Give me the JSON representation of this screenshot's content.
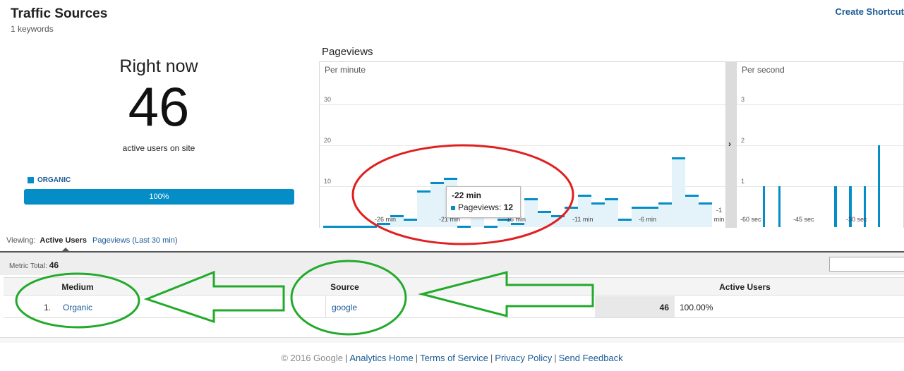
{
  "header": {
    "title": "Traffic Sources",
    "subtitle": "1 keywords",
    "create_shortcut": "Create Shortcut"
  },
  "right_now": {
    "heading": "Right now",
    "count": "46",
    "caption": "active users on site",
    "legend_label": "ORGANIC",
    "share_percent": "100%",
    "share_fraction": 1.0
  },
  "pageviews": {
    "title": "Pageviews",
    "per_minute_label": "Per minute",
    "per_second_label": "Per second",
    "divider_icon": "chevron-right-icon"
  },
  "chart_data": [
    {
      "type": "bar",
      "title": "Per minute",
      "y_ticks": [
        "10",
        "20",
        "30"
      ],
      "ylim": [
        0,
        30
      ],
      "x_ticks": [
        "-26 min",
        "-21 min",
        "-16 min",
        "-11 min",
        "-6 min",
        "-1 min"
      ],
      "values": [
        0,
        0,
        0,
        0,
        1,
        3,
        2,
        9,
        11,
        12,
        0,
        3,
        0,
        2,
        1,
        7,
        4,
        3,
        5,
        8,
        6,
        7,
        2,
        5,
        5,
        6,
        17,
        8,
        6
      ],
      "color": "#058dc7",
      "tooltip": {
        "label": "-22 min",
        "series": "Pageviews:",
        "value": "12"
      }
    },
    {
      "type": "bar",
      "title": "Per second",
      "y_ticks": [
        "1",
        "2",
        "3"
      ],
      "ylim": [
        0,
        3
      ],
      "x_ticks": [
        "-60 sec",
        "-45 sec",
        "-30 sec"
      ],
      "values": [
        1,
        1,
        1,
        1,
        1,
        1,
        1,
        2
      ],
      "color": "#058dc7"
    }
  ],
  "viewing": {
    "label": "Viewing:",
    "active": "Active Users",
    "other": "Pageviews (Last 30 min)"
  },
  "metric_total": {
    "label": "Metric Total:",
    "value": "46"
  },
  "table": {
    "headers": {
      "medium": "Medium",
      "source": "Source",
      "active_users": "Active Users"
    },
    "rows": [
      {
        "index": "1.",
        "medium": "Organic",
        "source": "google",
        "active_users": "46",
        "percent": "100.00%"
      }
    ]
  },
  "footer": {
    "copyright": "© 2016 Google",
    "links": [
      "Analytics Home",
      "Terms of Service",
      "Privacy Policy",
      "Send Feedback"
    ]
  },
  "annotation_colors": {
    "red": "#e02020",
    "green": "#22aa2a"
  }
}
